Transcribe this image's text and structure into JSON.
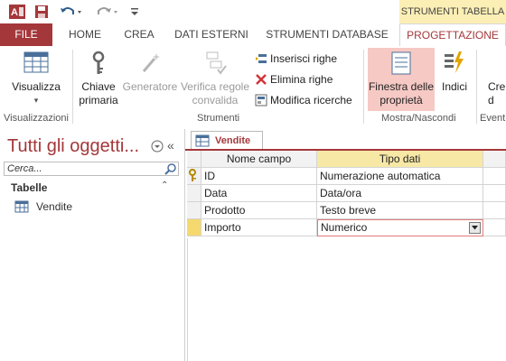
{
  "quick_access": {
    "app_icon": "access-app-icon",
    "save_icon": "save-icon",
    "undo_icon": "undo-icon",
    "redo_icon": "redo-icon",
    "customize_icon": "customize-icon"
  },
  "context_header": "STRUMENTI TABELLA",
  "tabs": {
    "file": "FILE",
    "home": "HOME",
    "crea": "CREA",
    "dati_esterni": "DATI ESTERNI",
    "strumenti_database": "STRUMENTI DATABASE",
    "progettazione": "PROGETTAZIONE"
  },
  "ribbon": {
    "visualizza": "Visualizza",
    "visualizza_arrow": "▾",
    "chiave_line1": "Chiave",
    "chiave_line2": "primaria",
    "generatore": "Generatore",
    "verifica_line1": "Verifica regole",
    "verifica_line2": "convalida",
    "inserisci_righe": "Inserisci righe",
    "elimina_righe": "Elimina righe",
    "modifica_ricerche": "Modifica ricerche",
    "finestra_line1": "Finestra delle",
    "finestra_line2": "proprietà",
    "indici": "Indici",
    "cre_line1": "Cre",
    "cre_line2": "d",
    "groups": {
      "visualizzazioni": "Visualizzazioni",
      "strumenti": "Strumenti",
      "mostra_nascondi": "Mostra/Nascondi",
      "eventi": "Event"
    }
  },
  "nav": {
    "title": "Tutti gli oggetti...",
    "search_placeholder": "Cerca...",
    "section": "Tabelle",
    "items": [
      {
        "label": "Vendite"
      }
    ]
  },
  "document": {
    "tab_label": "Vendite",
    "headers": {
      "name": "Nome campo",
      "type": "Tipo dati"
    },
    "rows": [
      {
        "name": "ID",
        "type": "Numerazione automatica",
        "primary_key": true
      },
      {
        "name": "Data",
        "type": "Data/ora"
      },
      {
        "name": "Prodotto",
        "type": "Testo breve"
      },
      {
        "name": "Importo",
        "type": "Numerico",
        "current": true
      }
    ]
  },
  "colors": {
    "accent": "#a4373a",
    "context_tab": "#fcefb5",
    "header_highlight": "#f7e8a6",
    "selector_highlight": "#f5d86e",
    "active_button": "#f6c9c4"
  }
}
